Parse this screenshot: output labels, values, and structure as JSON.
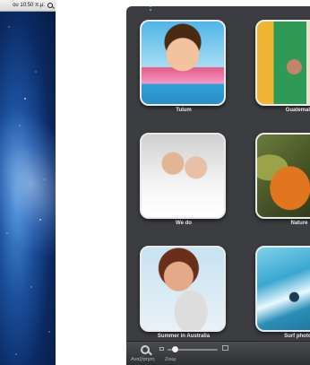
{
  "menubar": {
    "time": "ου 10:50 π.μ."
  },
  "photos": [
    {
      "label": "Tulum"
    },
    {
      "label": "Guatemala"
    },
    {
      "label": "We do"
    },
    {
      "label": "Nature"
    },
    {
      "label": "Summer in Australia"
    },
    {
      "label": "Surf photos"
    }
  ],
  "toolbar": {
    "search_label": "Αναζήτηση",
    "zoom_label": "Ζουμ",
    "zoom_level": 0.15
  }
}
